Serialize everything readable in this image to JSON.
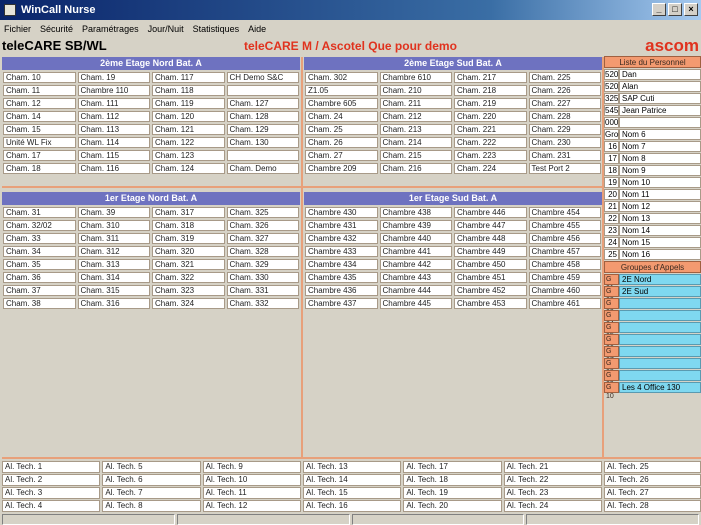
{
  "window": {
    "title": "WinCall Nurse"
  },
  "menu": [
    "Fichier",
    "Sécurité",
    "Paramétrages",
    "Jour/Nuit",
    "Statistiques",
    "Aide"
  ],
  "header": {
    "left": "teleCARE SB/WL",
    "center": "teleCARE M / Ascotel  Que pour demo",
    "right": "ascom"
  },
  "sections": [
    {
      "title": "2ème Etage Nord Bat. A",
      "cells": [
        "Cham. 10",
        "Cham. 19",
        "Cham. 117",
        "CH Demo S&C",
        "Cham. 11",
        "Chambre 110",
        "Cham. 118",
        "",
        "Cham. 12",
        "Cham. 111",
        "Cham. 119",
        "Cham. 127",
        "Cham. 14",
        "Cham. 112",
        "Cham. 120",
        "Cham. 128",
        "Cham. 15",
        "Cham. 113",
        "Cham. 121",
        "Cham. 129",
        "Unité WL Fix",
        "Cham. 114",
        "Cham. 122",
        "Cham. 130",
        "Cham. 17",
        "Cham. 115",
        "Cham. 123",
        "",
        "Cham. 18",
        "Cham. 116",
        "Cham. 124",
        "Cham. Demo"
      ]
    },
    {
      "title": "2ème Etage Sud Bat. A",
      "cells": [
        "Cham. 302",
        "Chambre 610",
        "Cham. 217",
        "Cham. 225",
        "Z1.05",
        "Cham. 210",
        "Cham. 218",
        "Cham. 226",
        "Chambre 605",
        "Cham. 211",
        "Cham. 219",
        "Cham. 227",
        "Cham. 24",
        "Cham. 212",
        "Cham. 220",
        "Cham. 228",
        "Cham. 25",
        "Cham. 213",
        "Cham. 221",
        "Cham. 229",
        "Cham. 26",
        "Cham. 214",
        "Cham. 222",
        "Cham. 230",
        "Cham. 27",
        "Cham. 215",
        "Cham. 223",
        "Cham. 231",
        "Chambre 209",
        "Cham. 216",
        "Cham. 224",
        "Test Port 2"
      ]
    },
    {
      "title": "1er Etage Nord Bat. A",
      "cells": [
        "Cham. 31",
        "Cham. 39",
        "Cham. 317",
        "Cham. 325",
        "Cham. 32/02",
        "Cham. 310",
        "Cham. 318",
        "Cham. 326",
        "Cham. 33",
        "Cham. 311",
        "Cham. 319",
        "Cham. 327",
        "Cham. 34",
        "Cham. 312",
        "Cham. 320",
        "Cham. 328",
        "Cham. 35",
        "Cham. 313",
        "Cham. 321",
        "Cham. 329",
        "Cham. 36",
        "Cham. 314",
        "Cham. 322",
        "Cham. 330",
        "Cham. 37",
        "Cham. 315",
        "Cham. 323",
        "Cham. 331",
        "Cham. 38",
        "Cham. 316",
        "Cham. 324",
        "Cham. 332"
      ]
    },
    {
      "title": "1er Etage Sud Bat. A",
      "cells": [
        "Chambre 430",
        "Chambre 438",
        "Chambre 446",
        "Chambre 454",
        "Chambre 431",
        "Chambre 439",
        "Chambre 447",
        "Chambre 455",
        "Chambre 432",
        "Chambre 440",
        "Chambre 448",
        "Chambre 456",
        "Chambre 433",
        "Chambre 441",
        "Chambre 449",
        "Chambre 457",
        "Chambre 434",
        "Chambre 442",
        "Chambre 450",
        "Chambre 458",
        "Chambre 435",
        "Chambre 443",
        "Chambre 451",
        "Chambre 459",
        "Chambre 436",
        "Chambre 444",
        "Chambre 452",
        "Chambre 460",
        "Chambre 437",
        "Chambre 445",
        "Chambre 453",
        "Chambre 461"
      ]
    }
  ],
  "staff": {
    "title": "Liste du Personnel",
    "rows": [
      {
        "num": "5201",
        "name": "Dan"
      },
      {
        "num": "5202",
        "name": "Alan"
      },
      {
        "num": "325",
        "name": "SAP Cuti"
      },
      {
        "num": "5457",
        "name": "Jean Patrice"
      },
      {
        "num": "000",
        "name": ""
      },
      {
        "num": "Grou",
        "name": "Nom 6"
      },
      {
        "num": "16",
        "name": "Nom 7"
      },
      {
        "num": "17",
        "name": "Nom 8"
      },
      {
        "num": "18",
        "name": "Nom 9"
      },
      {
        "num": "19",
        "name": "Nom 10"
      },
      {
        "num": "20",
        "name": "Nom 11"
      },
      {
        "num": "21",
        "name": "Nom 12"
      },
      {
        "num": "22",
        "name": "Nom 13"
      },
      {
        "num": "23",
        "name": "Nom 14"
      },
      {
        "num": "24",
        "name": "Nom 15"
      },
      {
        "num": "25",
        "name": "Nom 16"
      }
    ]
  },
  "groups": {
    "title": "Groupes d'Appels",
    "rows": [
      {
        "id": "G 01",
        "name": "2E Nord"
      },
      {
        "id": "G 02",
        "name": "2E Sud"
      },
      {
        "id": "G 03",
        "name": ""
      },
      {
        "id": "G 04",
        "name": ""
      },
      {
        "id": "G 05",
        "name": ""
      },
      {
        "id": "G 06",
        "name": ""
      },
      {
        "id": "G 07",
        "name": ""
      },
      {
        "id": "G 08",
        "name": ""
      },
      {
        "id": "G 09",
        "name": ""
      },
      {
        "id": "G 10",
        "name": "Les 4 Office 130"
      }
    ]
  },
  "tech": [
    "Al. Tech. 1",
    "Al. Tech. 5",
    "Al. Tech. 9",
    "Al. Tech. 13",
    "Al. Tech. 17",
    "Al. Tech. 21",
    "Al. Tech. 2",
    "Al. Tech. 6",
    "Al. Tech. 10",
    "Al. Tech. 14",
    "Al. Tech. 18",
    "Al. Tech. 22",
    "Al. Tech. 3",
    "Al. Tech. 7",
    "Al. Tech. 11",
    "Al. Tech. 15",
    "Al. Tech. 19",
    "Al. Tech. 23",
    "Al. Tech. 4",
    "Al. Tech. 8",
    "Al. Tech. 12",
    "Al. Tech. 16",
    "Al. Tech. 20",
    "Al. Tech. 24"
  ],
  "tech_right": [
    "Al. Tech. 25",
    "Al. Tech. 26",
    "Al. Tech. 27",
    "Al. Tech. 28"
  ],
  "controls": {
    "minimize": "_",
    "maximize": "□",
    "close": "×"
  }
}
